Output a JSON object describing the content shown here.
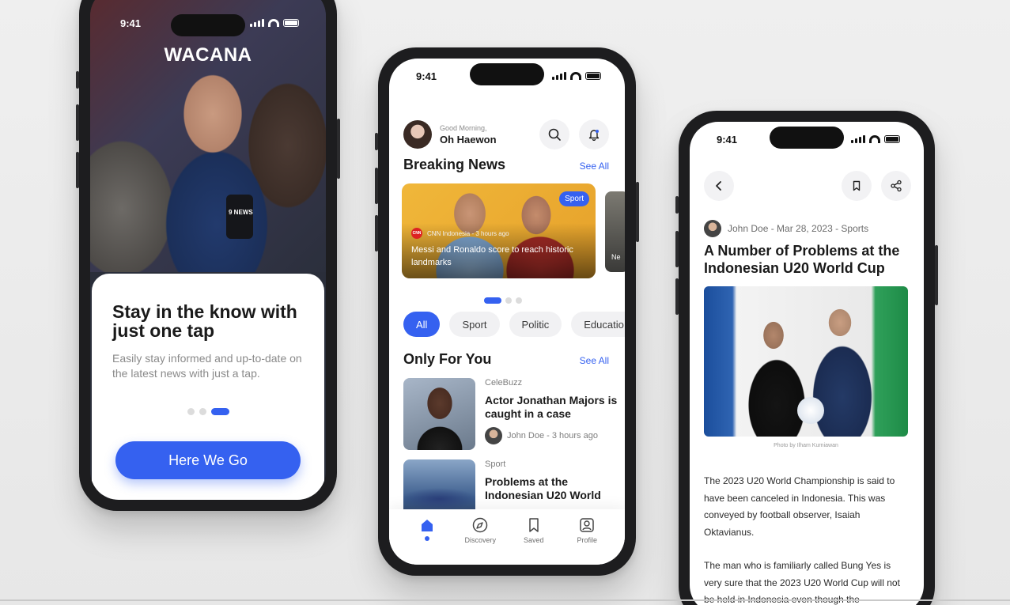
{
  "phone1": {
    "status_time": "9:41",
    "brand": "WACANA",
    "mic_label": "9 NEWS",
    "headline": "Stay in the know with just one tap",
    "description": "Easily stay informed and up-to-date on the latest news with just a tap.",
    "button_label": "Here We Go",
    "pagination": {
      "total": 3,
      "active": 3
    }
  },
  "phone2": {
    "status_time": "9:41",
    "greeting": "Good Morning,",
    "user_name": "Oh Haewon",
    "breaking": {
      "title": "Breaking News",
      "see_all": "See All",
      "card": {
        "tag": "Sport",
        "source_logo": "CNN",
        "source": "CNN Indonesia - 3 hours ago",
        "title": "Messi and Ronaldo score to reach historic landmarks"
      },
      "next_card_text": "Ne",
      "pagination": {
        "total": 3,
        "active": 1
      }
    },
    "chips": [
      "All",
      "Sport",
      "Politic",
      "Educatio"
    ],
    "active_chip": "All",
    "only_for_you": {
      "title": "Only For You",
      "see_all": "See All",
      "items": [
        {
          "category": "CeleBuzz",
          "title": "Actor Jonathan Majors is caught in a case",
          "meta": "John Doe - 3 hours ago"
        },
        {
          "category": "Sport",
          "title": "Problems at the Indonesian U20 World",
          "meta": ""
        }
      ]
    },
    "tabs": [
      {
        "label": "",
        "icon": "home-icon",
        "active": true
      },
      {
        "label": "Discovery",
        "icon": "compass-icon",
        "active": false
      },
      {
        "label": "Saved",
        "icon": "bookmark-icon",
        "active": false
      },
      {
        "label": "Profile",
        "icon": "profile-icon",
        "active": false
      }
    ]
  },
  "phone3": {
    "status_time": "9:41",
    "byline": "John Doe - Mar 28, 2023 - Sports",
    "headline": "A Number of Problems at the Indonesian U20 World Cup",
    "photo_caption": "Photo by Ilham Kurniawan",
    "paragraphs": [
      "The 2023 U20 World Championship is said to have been canceled in Indonesia. This was conveyed by football observer, Isaiah Oktavianus.",
      "The man who is familiarly called Bung Yes is very sure that the 2023 U20 World Cup will not be held in Indonesia even though the government has not officially announced it."
    ]
  },
  "colors": {
    "accent": "#3561f0",
    "text": "#1a1a1a",
    "muted": "#8a8a8a",
    "chip_bg": "#f1f1f3"
  }
}
